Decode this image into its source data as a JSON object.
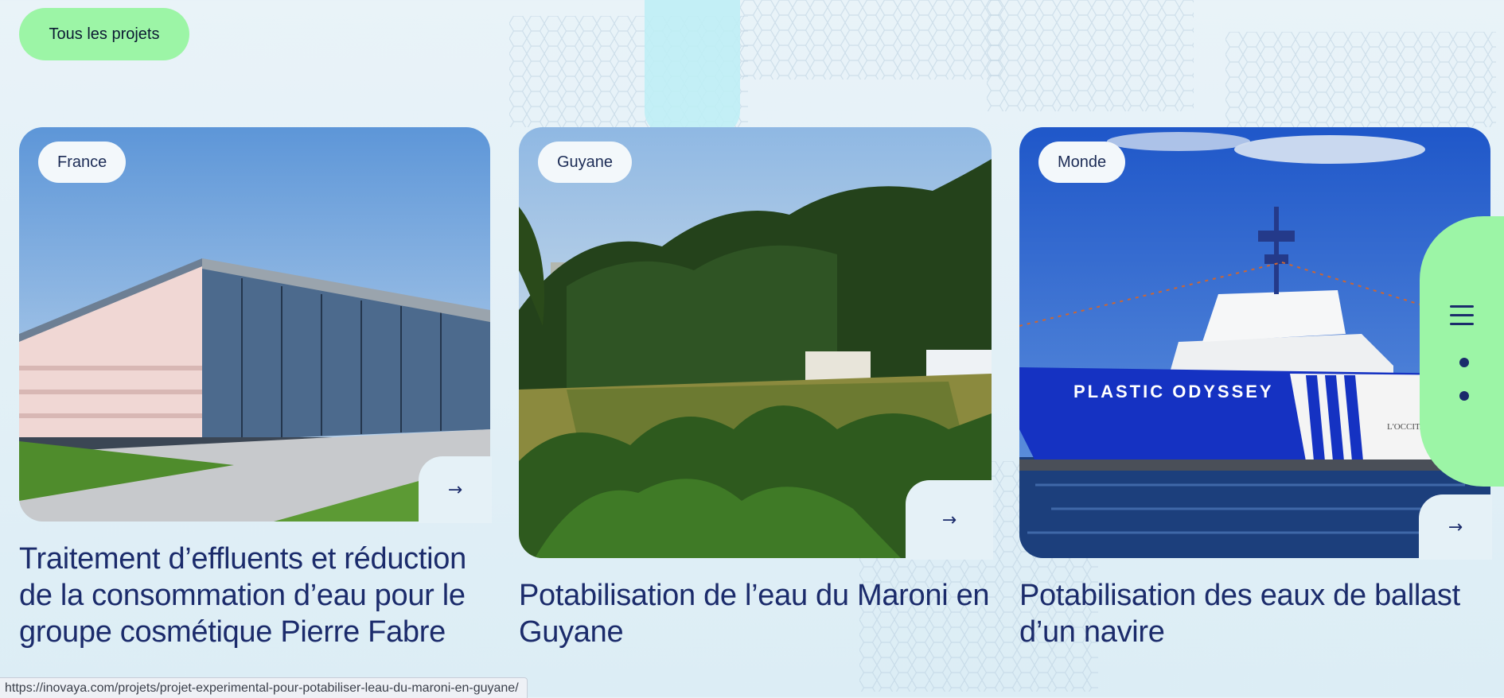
{
  "nav": {
    "all_projects_label": "Tous les projets"
  },
  "projects": [
    {
      "tag": "France",
      "title": "Traitement d’effluents et réduction de la consommation d’eau pour le groupe cosmétique Pierre Fabre",
      "arrow_icon": "arrow-right-icon"
    },
    {
      "tag": "Guyane",
      "title": "Potabilisation de l’eau du Maroni en Guyane",
      "arrow_icon": "arrow-right-icon"
    },
    {
      "tag": "Monde",
      "title": "Potabilisation des eaux de ballast d’un navire",
      "arrow_icon": "arrow-right-icon",
      "ship_name": "PLASTIC ODYSSEY",
      "ship_brand": "L'OCCITANE"
    }
  ],
  "menu": {
    "icon": "hamburger-menu-icon"
  },
  "status_bar": {
    "url": "https://inovaya.com/projets/projet-experimental-pour-potabiliser-leau-du-maroni-en-guyane/"
  },
  "colors": {
    "accent_green": "#9cf5a6",
    "title_navy": "#1b2b6b",
    "background": "#e3f0f6"
  }
}
